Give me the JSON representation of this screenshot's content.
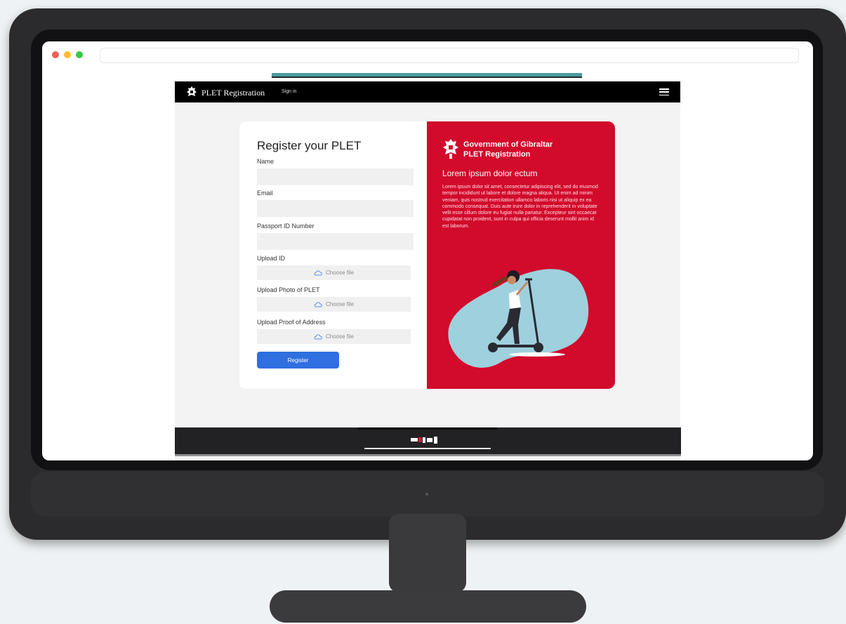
{
  "navbar": {
    "title": "PLET Registration",
    "signin": "Sign in",
    "menu_icon": "hamburger-menu-icon"
  },
  "form": {
    "title": "Register your PLET",
    "fields": [
      {
        "label": "Name",
        "value": "",
        "placeholder": ""
      },
      {
        "label": "Email",
        "value": "",
        "placeholder": ""
      },
      {
        "label": "Passport ID Number",
        "value": "",
        "placeholder": ""
      }
    ],
    "uploads": [
      {
        "label": "Upload ID",
        "button": "Choose file"
      },
      {
        "label": "Upload Photo of PLET",
        "button": "Choose file"
      },
      {
        "label": "Upload Proof of Address",
        "button": "Choose file"
      }
    ],
    "submit": "Register"
  },
  "info": {
    "gov_name": "Government of Gibraltar",
    "gov_sub": "PLET Registration",
    "heading": "Lorem ipsum dolor ectum",
    "body": "Lorem ipsum dolor sit amet, consectetur adipiscing elit, sed do eiusmod tempor incididunt ut labore et dolore magna aliqua. Ut enim ad minim veniam, quis nostrud exercitation ullamco laboris nisi ut aliquip ex ea commodo consequat. Duis aute irure dolor in reprehenderit in voluptate velit esse cillum dolore eu fugiat nulla pariatur. Excepteur sint occaecat cupidatat non proident, sunt in culpa qui officia deserunt mollit anim id est laborum."
  },
  "colors": {
    "accent_red": "#d20a2b",
    "button_blue": "#2f6fe0",
    "nav_black": "#000000",
    "illustration_blob": "#9fd0dd"
  },
  "icons": [
    "crest-icon",
    "cloud-upload-icon",
    "hamburger-menu-icon",
    "scooter-rider-illustration",
    "flag-logo-icon"
  ]
}
